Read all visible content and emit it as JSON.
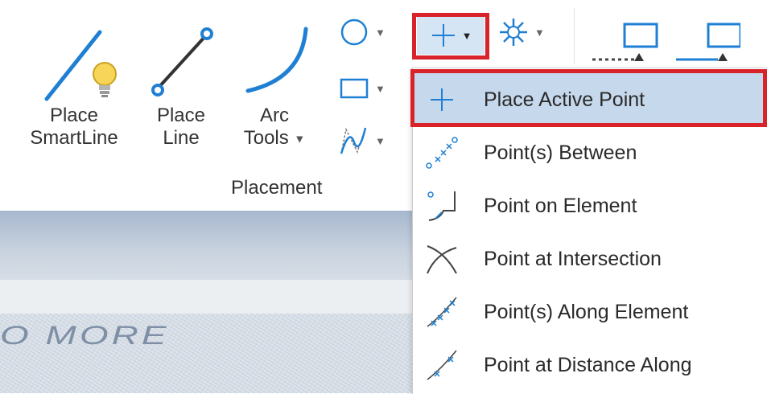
{
  "ribbon": {
    "tools": [
      {
        "id": "place-smartline",
        "label_line1": "Place",
        "label_line2": "SmartLine",
        "icon": "smartline-bulb-icon"
      },
      {
        "id": "place-line",
        "label_line1": "Place",
        "label_line2": "Line",
        "icon": "line-icon"
      },
      {
        "id": "arc-tools",
        "label_line1": "Arc",
        "label_line2": "Tools",
        "icon": "arc-icon"
      }
    ],
    "group_label": "Placement",
    "small_buttons": [
      "circle-icon",
      "rectangle-icon",
      "bspline-icon"
    ],
    "top_buttons": [
      "point-icon",
      "sun-icon"
    ],
    "far_right_icons": [
      "display-rect-icon",
      "display-rect-icon"
    ]
  },
  "background": {
    "partial_text": "O  MORE"
  },
  "menu": {
    "items": [
      {
        "label": "Place Active Point",
        "icon": "crosshair-icon",
        "active": true
      },
      {
        "label": "Point(s) Between",
        "icon": "points-between-icon",
        "active": false
      },
      {
        "label": "Point on Element",
        "icon": "point-on-element-icon",
        "active": false
      },
      {
        "label": "Point at Intersection",
        "icon": "intersection-icon",
        "active": false
      },
      {
        "label": "Point(s) Along Element",
        "icon": "points-along-icon",
        "active": false
      },
      {
        "label": "Point at Distance Along",
        "icon": "distance-along-icon",
        "active": false
      }
    ]
  },
  "colors": {
    "highlight_border": "#d8232a",
    "active_bg": "#c5d8ec",
    "icon_blue": "#1f7fd3"
  }
}
